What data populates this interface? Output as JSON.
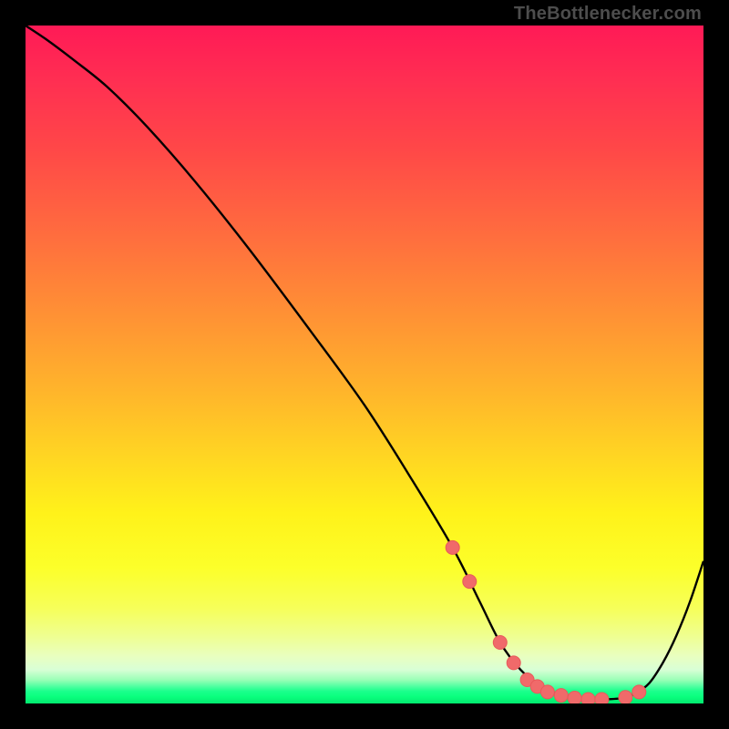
{
  "attribution": "TheBottlenecker.com",
  "colors": {
    "page_bg": "#000000",
    "curve_stroke": "#000000",
    "marker_fill": "#f06a6a",
    "marker_stroke": "#e85a5a",
    "attribution_text": "#4d4d4d"
  },
  "chart_data": {
    "type": "line",
    "title": "",
    "xlabel": "",
    "ylabel": "",
    "xlim": [
      0,
      100
    ],
    "ylim": [
      0,
      100
    ],
    "notes": "Bottleneck-style curve: high at left, descends nearly linearly, flattens near zero around x≈70–88, rises again toward right. Markers cluster in the flat valley.",
    "series": [
      {
        "name": "curve",
        "x": [
          0,
          3,
          7,
          12,
          18,
          25,
          33,
          42,
          50,
          57,
          63,
          67,
          70,
          73,
          76,
          79,
          82,
          85,
          88,
          90,
          92,
          94,
          96,
          98,
          100
        ],
        "values": [
          100,
          98,
          95,
          91,
          85,
          77,
          67,
          55,
          44,
          33,
          23,
          15,
          9,
          5,
          2.5,
          1.2,
          0.7,
          0.6,
          0.8,
          1.5,
          3,
          6,
          10,
          15,
          21
        ]
      }
    ],
    "markers": {
      "name": "highlighted-points",
      "x": [
        63,
        65.5,
        70,
        72,
        74,
        75.5,
        77,
        79,
        81,
        83,
        85,
        88.5,
        90.5
      ],
      "values": [
        23,
        18,
        9,
        6,
        3.5,
        2.5,
        1.7,
        1.2,
        0.8,
        0.6,
        0.6,
        0.9,
        1.7
      ]
    }
  }
}
